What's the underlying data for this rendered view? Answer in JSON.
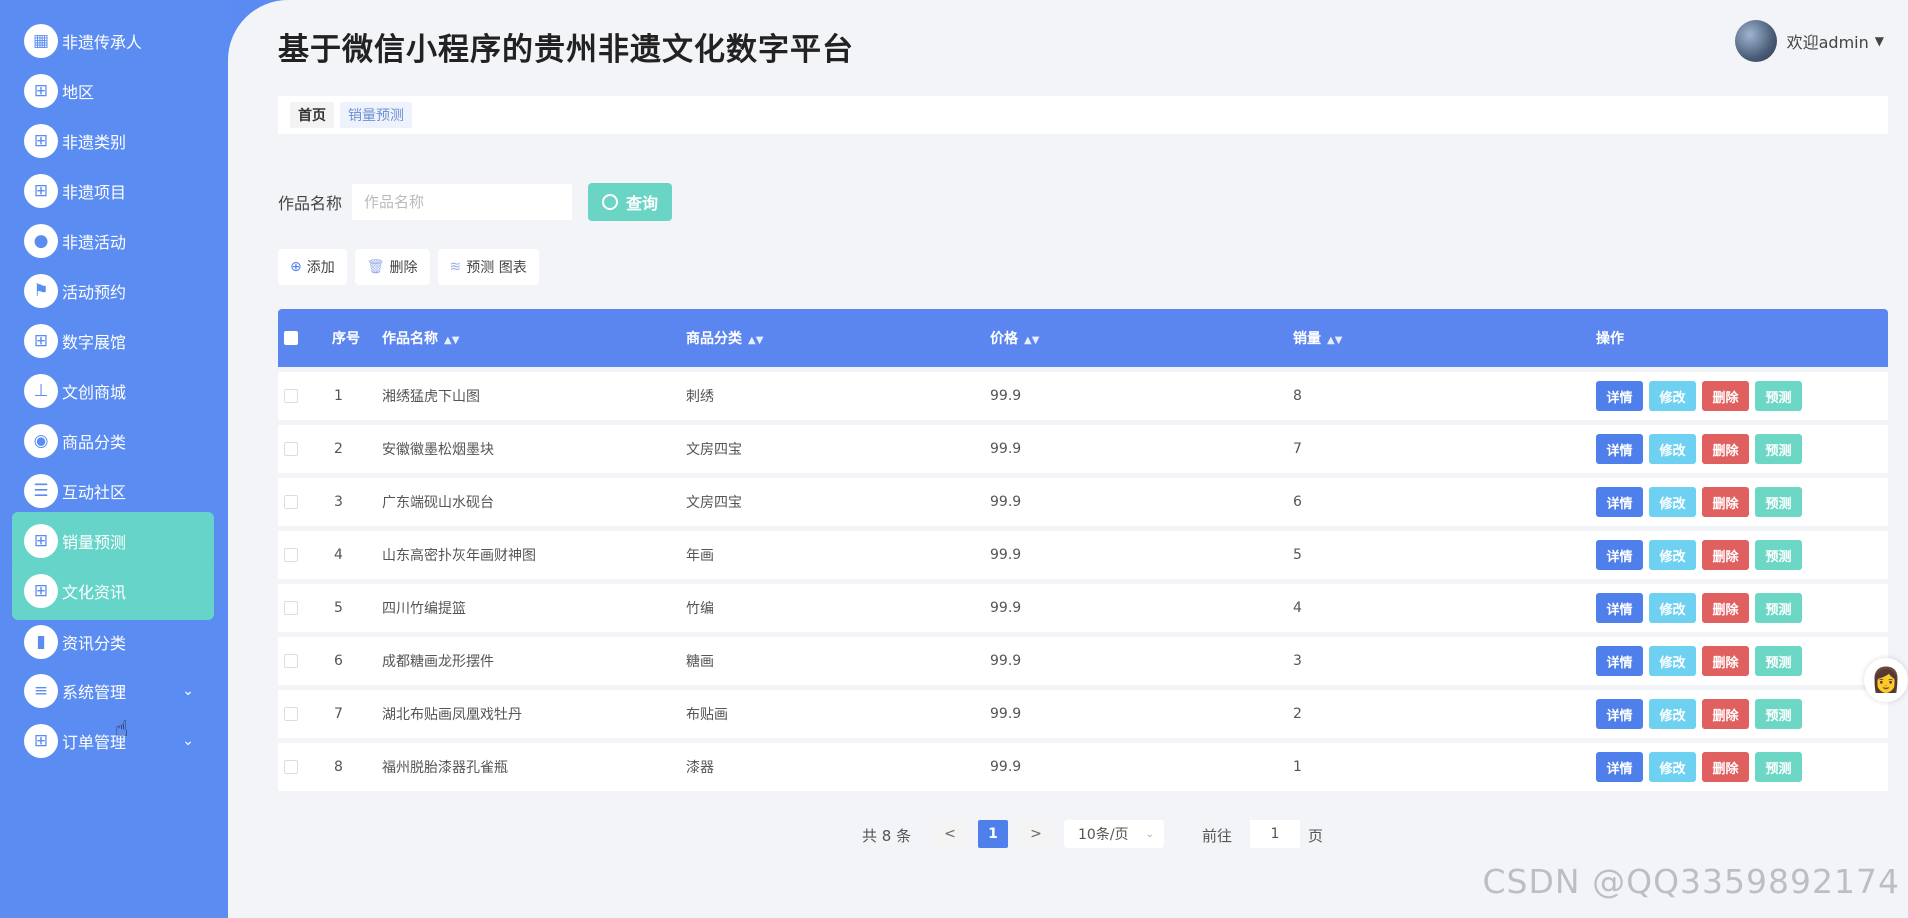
{
  "sidebar": {
    "items": [
      {
        "label": "非遗传承人",
        "icon": "grid-icon"
      },
      {
        "label": "地区",
        "icon": "apps-icon"
      },
      {
        "label": "非遗类别",
        "icon": "apps-icon"
      },
      {
        "label": "非遗项目",
        "icon": "apps-icon"
      },
      {
        "label": "非遗活动",
        "icon": "user-icon"
      },
      {
        "label": "活动预约",
        "icon": "flag-icon"
      },
      {
        "label": "数字展馆",
        "icon": "apps-icon"
      },
      {
        "label": "文创商城",
        "icon": "stamp-icon"
      },
      {
        "label": "商品分类",
        "icon": "balloon-icon"
      },
      {
        "label": "互动社区",
        "icon": "list-icon"
      },
      {
        "label": "销量预测",
        "icon": "apps-icon",
        "active": true
      },
      {
        "label": "文化资讯",
        "icon": "apps-icon",
        "active": true
      },
      {
        "label": "资讯分类",
        "icon": "bar-chart-icon"
      },
      {
        "label": "系统管理",
        "icon": "sliders-icon",
        "expandable": true
      },
      {
        "label": "订单管理",
        "icon": "apps-icon",
        "expandable": true
      }
    ]
  },
  "header": {
    "title": "基于微信小程序的贵州非遗文化数字平台",
    "user_label": "欢迎admin"
  },
  "breadcrumb": {
    "home": "首页",
    "current": "销量预测"
  },
  "search": {
    "label": "作品名称",
    "placeholder": "作品名称",
    "button": "查询"
  },
  "toolbar": {
    "add": "添加",
    "delete": "删除",
    "predict_chart": "预测 图表"
  },
  "table": {
    "columns": [
      "序号",
      "作品名称",
      "商品分类",
      "价格",
      "销量",
      "操作"
    ],
    "rows": [
      {
        "no": "1",
        "name": "湘绣猛虎下山图",
        "category": "刺绣",
        "price": "99.9",
        "sales": "8"
      },
      {
        "no": "2",
        "name": "安徽徽墨松烟墨块",
        "category": "文房四宝",
        "price": "99.9",
        "sales": "7"
      },
      {
        "no": "3",
        "name": "广东端砚山水砚台",
        "category": "文房四宝",
        "price": "99.9",
        "sales": "6"
      },
      {
        "no": "4",
        "name": "山东高密扑灰年画财神图",
        "category": "年画",
        "price": "99.9",
        "sales": "5"
      },
      {
        "no": "5",
        "name": "四川竹编提篮",
        "category": "竹编",
        "price": "99.9",
        "sales": "4"
      },
      {
        "no": "6",
        "name": "成都糖画龙形摆件",
        "category": "糖画",
        "price": "99.9",
        "sales": "3"
      },
      {
        "no": "7",
        "name": "湖北布贴画凤凰戏牡丹",
        "category": "布贴画",
        "price": "99.9",
        "sales": "2"
      },
      {
        "no": "8",
        "name": "福州脱胎漆器孔雀瓶",
        "category": "漆器",
        "price": "99.9",
        "sales": "1"
      }
    ],
    "actions": {
      "detail": "详情",
      "edit": "修改",
      "delete": "删除",
      "predict": "预测"
    }
  },
  "pagination": {
    "total": "共 8 条",
    "prev": "<",
    "current": "1",
    "next": ">",
    "page_size": "10条/页",
    "goto_label": "前往",
    "goto_value": "1",
    "page_suffix": "页"
  },
  "watermark": "CSDN @QQ3359892174",
  "colors": {
    "sidebar_bg": "#5b8cf2",
    "active_item": "#66d4c8",
    "table_header": "#5b86f0",
    "btn_detail": "#4f7fea",
    "btn_edit": "#6fd1f2",
    "btn_delete": "#e06060",
    "btn_predict": "#6dd7c6"
  }
}
